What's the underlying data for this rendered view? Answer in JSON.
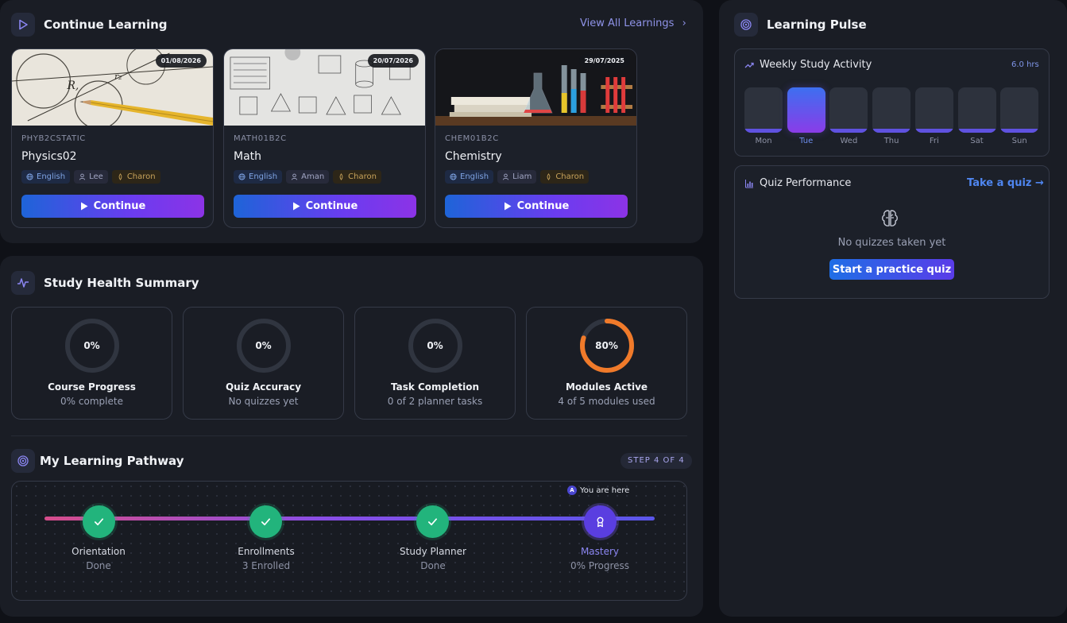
{
  "continue_learning": {
    "title": "Continue Learning",
    "view_all": "View All Learnings",
    "courses": [
      {
        "date": "01/08/2026",
        "code": "PHYB2CSTATIC",
        "name": "Physics02",
        "language": "English",
        "tutor": "Lee",
        "voice": "Charon",
        "button": "Continue"
      },
      {
        "date": "20/07/2026",
        "code": "MATH01B2C",
        "name": "Math",
        "language": "English",
        "tutor": "Aman",
        "voice": "Charon",
        "button": "Continue"
      },
      {
        "date": "29/07/2025",
        "code": "CHEM01B2C",
        "name": "Chemistry",
        "language": "English",
        "tutor": "Liam",
        "voice": "Charon",
        "button": "Continue"
      }
    ]
  },
  "study_health": {
    "title": "Study Health Summary",
    "stats": [
      {
        "value": "0%",
        "percent": 0,
        "title": "Course Progress",
        "sub": "0% complete"
      },
      {
        "value": "0%",
        "percent": 0,
        "title": "Quiz Accuracy",
        "sub": "No quizzes yet"
      },
      {
        "value": "0%",
        "percent": 0,
        "title": "Task Completion",
        "sub": "0 of 2 planner tasks"
      },
      {
        "value": "80%",
        "percent": 80,
        "title": "Modules Active",
        "sub": "4 of 5 modules used"
      }
    ]
  },
  "pathway": {
    "title": "My Learning Pathway",
    "step_badge": "STEP 4 OF 4",
    "here_marker": "A",
    "here_label": "You are here",
    "steps": [
      {
        "label": "Orientation",
        "sub": "Done",
        "status": "done"
      },
      {
        "label": "Enrollments",
        "sub": "3 Enrolled",
        "status": "done"
      },
      {
        "label": "Study Planner",
        "sub": "Done",
        "status": "done"
      },
      {
        "label": "Mastery",
        "sub": "0% Progress",
        "status": "current"
      }
    ]
  },
  "pulse": {
    "title": "Learning Pulse",
    "weekly": {
      "title": "Weekly Study Activity",
      "total": "6.0 hrs",
      "days": [
        "Mon",
        "Tue",
        "Wed",
        "Thu",
        "Fri",
        "Sat",
        "Sun"
      ],
      "active_day": "Tue"
    },
    "quiz": {
      "title": "Quiz Performance",
      "take_quiz": "Take a quiz →",
      "empty": "No quizzes taken yet",
      "button": "Start a practice quiz"
    }
  },
  "colors": {
    "accent": "#6a3cf0",
    "done": "#22b47c",
    "ring": "#f07a2a"
  }
}
